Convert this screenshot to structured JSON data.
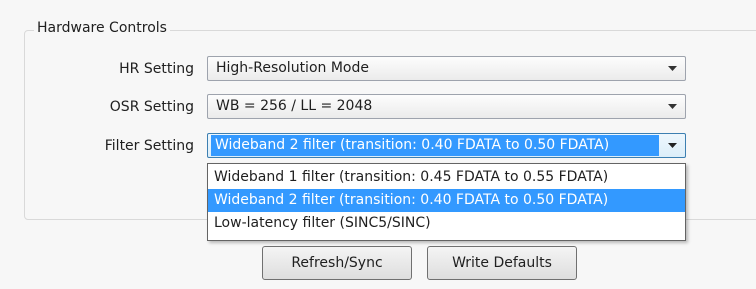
{
  "hardware_controls": {
    "title": "Hardware Controls",
    "hr_setting": {
      "label": "HR Setting",
      "value": "High-Resolution Mode"
    },
    "osr_setting": {
      "label": "OSR Setting",
      "value": "WB = 256 / LL = 2048"
    },
    "filter_setting": {
      "label": "Filter Setting",
      "value": "Wideband 2 filter (transition: 0.40 FDATA to 0.50 FDATA)",
      "options": [
        "Wideband 1 filter (transition: 0.45 FDATA to 0.55 FDATA)",
        "Wideband 2 filter (transition: 0.40 FDATA to 0.50 FDATA)",
        "Low-latency filter (SINC5/SINC)"
      ],
      "selected_index": 1
    }
  },
  "buttons": {
    "refresh_label": "Refresh/Sync",
    "write_defaults_label": "Write Defaults"
  },
  "icons": {
    "combo_arrow": "chevron-down-icon"
  },
  "colors": {
    "selection": "#3399ff",
    "active_border": "#3c7fb1"
  }
}
